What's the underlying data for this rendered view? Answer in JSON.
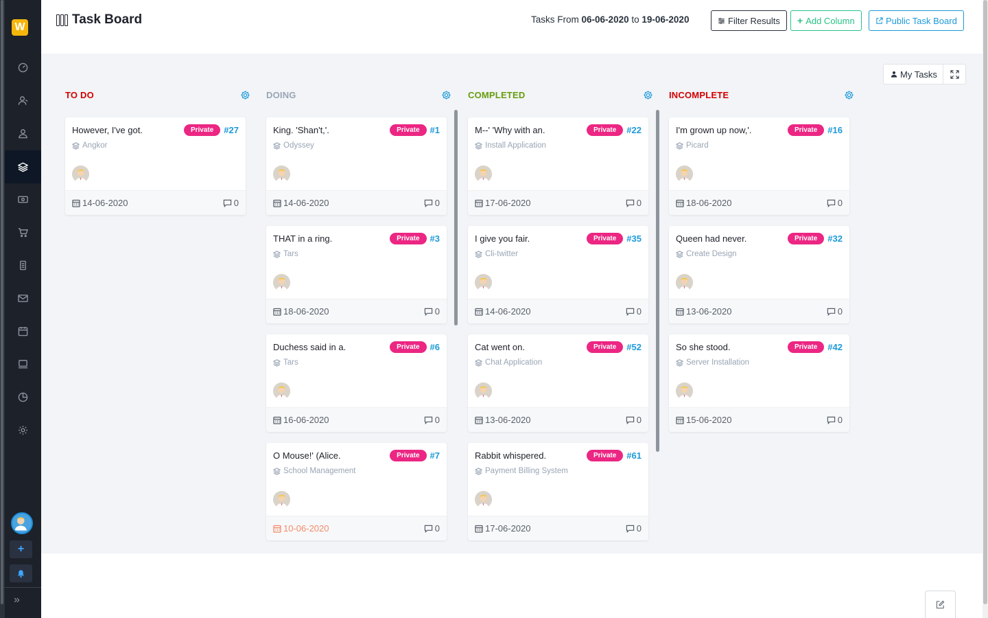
{
  "app": {
    "logo_letter": "W"
  },
  "header": {
    "title": "Task Board",
    "range_prefix": "Tasks From",
    "range_start": "06-06-2020",
    "range_joiner": "to",
    "range_end": "19-06-2020",
    "filter_label": "Filter Results",
    "add_column_label": "Add Column",
    "public_board_label": "Public Task Board"
  },
  "toolbar": {
    "my_tasks_label": "My Tasks"
  },
  "sidebar": {
    "items": [
      {
        "name": "dashboard-icon"
      },
      {
        "name": "clients-icon"
      },
      {
        "name": "employees-icon"
      },
      {
        "name": "work-icon",
        "active": true
      },
      {
        "name": "finance-icon"
      },
      {
        "name": "orders-icon"
      },
      {
        "name": "contracts-icon"
      },
      {
        "name": "messages-icon"
      },
      {
        "name": "calendar-icon"
      },
      {
        "name": "assets-icon"
      },
      {
        "name": "reports-icon"
      },
      {
        "name": "settings-icon"
      }
    ]
  },
  "columns": [
    {
      "title": "TO DO",
      "color": "#d30000",
      "cards": [
        {
          "title": "However, I've got.",
          "badge": "Private",
          "id": "#27",
          "project": "Angkor",
          "due": "14-06-2020",
          "comments": "0"
        }
      ]
    },
    {
      "title": "DOING",
      "color": "#99a5b5",
      "cards": [
        {
          "title": "King. 'Shan't,'.",
          "badge": "Private",
          "id": "#1",
          "project": "Odyssey",
          "due": "14-06-2020",
          "comments": "0"
        },
        {
          "title": "THAT in a ring.",
          "badge": "Private",
          "id": "#3",
          "project": "Tars",
          "due": "18-06-2020",
          "comments": "0"
        },
        {
          "title": "Duchess said in a.",
          "badge": "Private",
          "id": "#6",
          "project": "Tars",
          "due": "16-06-2020",
          "comments": "0"
        },
        {
          "title": "O Mouse!' (Alice.",
          "badge": "Private",
          "id": "#7",
          "project": "School Management",
          "due": "10-06-2020",
          "comments": "0",
          "overdue": true
        }
      ]
    },
    {
      "title": "COMPLETED",
      "color": "#679c0d",
      "cards": [
        {
          "title": "M--' 'Why with an.",
          "badge": "Private",
          "id": "#22",
          "project": "Install Application",
          "due": "17-06-2020",
          "comments": "0"
        },
        {
          "title": "I give you fair.",
          "badge": "Private",
          "id": "#35",
          "project": "Cli-twitter",
          "due": "14-06-2020",
          "comments": "0"
        },
        {
          "title": "Cat went on.",
          "badge": "Private",
          "id": "#52",
          "project": "Chat Application",
          "due": "13-06-2020",
          "comments": "0"
        },
        {
          "title": "Rabbit whispered.",
          "badge": "Private",
          "id": "#61",
          "project": "Payment Billing System",
          "due": "17-06-2020",
          "comments": "0"
        }
      ]
    },
    {
      "title": "INCOMPLETE",
      "color": "#d30000",
      "cards": [
        {
          "title": "I'm grown up now,'.",
          "badge": "Private",
          "id": "#16",
          "project": "Picard",
          "due": "18-06-2020",
          "comments": "0"
        },
        {
          "title": "Queen had never.",
          "badge": "Private",
          "id": "#32",
          "project": "Create Design",
          "due": "13-06-2020",
          "comments": "0"
        },
        {
          "title": "So she stood.",
          "badge": "Private",
          "id": "#42",
          "project": "Server Installation",
          "due": "15-06-2020",
          "comments": "0"
        }
      ]
    }
  ]
}
